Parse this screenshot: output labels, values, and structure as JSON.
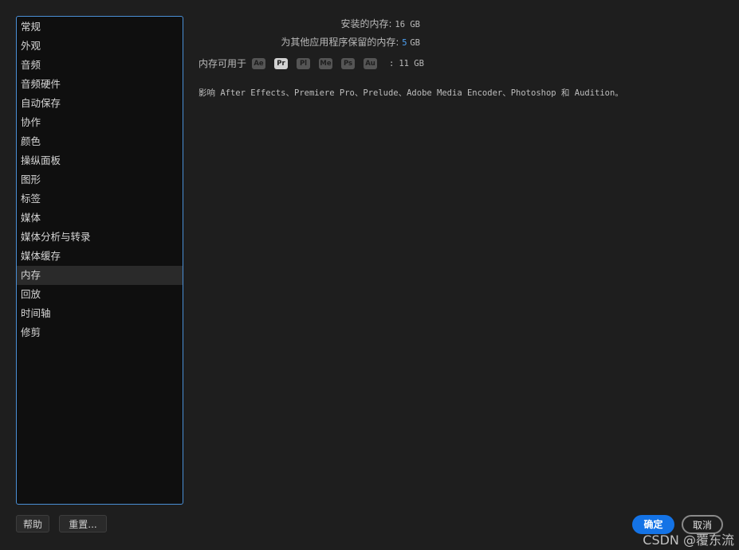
{
  "sidebar": {
    "items": [
      {
        "label": "常规"
      },
      {
        "label": "外观"
      },
      {
        "label": "音频"
      },
      {
        "label": "音频硬件"
      },
      {
        "label": "自动保存"
      },
      {
        "label": "协作"
      },
      {
        "label": "颜色"
      },
      {
        "label": "操纵面板"
      },
      {
        "label": "图形"
      },
      {
        "label": "标签"
      },
      {
        "label": "媒体"
      },
      {
        "label": "媒体分析与转录"
      },
      {
        "label": "媒体缓存"
      },
      {
        "label": "内存",
        "selected": true
      },
      {
        "label": "回放"
      },
      {
        "label": "时间轴"
      },
      {
        "label": "修剪"
      }
    ]
  },
  "memory": {
    "installed_label": "安装的内存:",
    "installed_value": "16 GB",
    "reserved_label": "为其他应用程序保留的内存:",
    "reserved_value": "5",
    "reserved_unit": "GB",
    "available_label": "内存可用于",
    "apps": [
      {
        "abbr": "Ae",
        "active": false
      },
      {
        "abbr": "Pr",
        "active": true
      },
      {
        "abbr": "Pl",
        "active": false
      },
      {
        "abbr": "Me",
        "active": false
      },
      {
        "abbr": "Ps",
        "active": false
      },
      {
        "abbr": "Au",
        "active": false
      }
    ],
    "available_colon": ":",
    "available_value": "11 GB",
    "affects_text": "影响 After Effects、Premiere Pro、Prelude、Adobe Media Encoder、Photoshop 和 Audition。"
  },
  "buttons": {
    "help": "帮助",
    "reset": "重置...",
    "ok": "确定",
    "cancel": "取消"
  },
  "watermark": "CSDN @覆东流",
  "colors": {
    "accent": "#1473e6",
    "sidebar_border": "#4a8fd6",
    "reserved_value": "#4fa3f7",
    "background": "#1e1e1e"
  }
}
